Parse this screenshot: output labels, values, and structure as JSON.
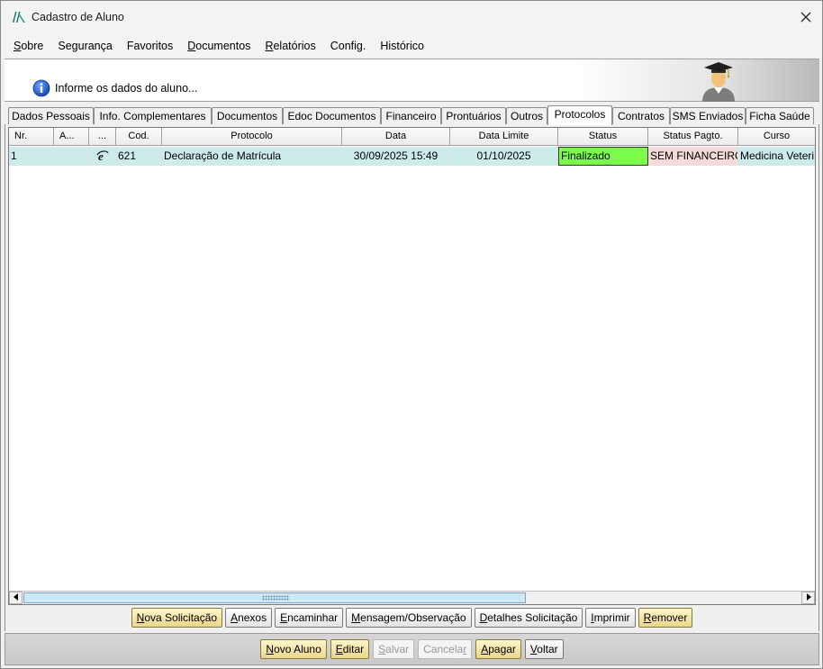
{
  "window": {
    "title": "Cadastro de Aluno"
  },
  "menu": [
    {
      "label": "Sobre",
      "underline": "S",
      "rest": "obre"
    },
    {
      "label": "Segurança",
      "underline": "",
      "rest": "Segurança"
    },
    {
      "label": "Favoritos",
      "underline": "",
      "rest": "Favoritos"
    },
    {
      "label": "Documentos",
      "underline": "D",
      "rest": "ocumentos"
    },
    {
      "label": "Relatórios",
      "underline": "R",
      "rest": "elatórios"
    },
    {
      "label": "Config.",
      "underline": "",
      "rest": "Config."
    },
    {
      "label": "Histórico",
      "underline": "",
      "rest": "Histórico"
    }
  ],
  "header": {
    "info_text": "Informe os dados do aluno..."
  },
  "tabs": [
    {
      "label": "Dados Pessoais"
    },
    {
      "label": "Info. Complementares"
    },
    {
      "label": "Documentos"
    },
    {
      "label": "Edoc Documentos"
    },
    {
      "label": "Financeiro"
    },
    {
      "label": "Prontuários"
    },
    {
      "label": "Outros"
    },
    {
      "label": "Protocolos",
      "active": true
    },
    {
      "label": "Contratos"
    },
    {
      "label": "SMS Enviados"
    },
    {
      "label": "Ficha Saúde"
    }
  ],
  "grid": {
    "columns": [
      "Nr.",
      "A...",
      "...",
      "Cod.",
      "Protocolo",
      "Data",
      "Data Limite",
      "Status",
      "Status Pagto.",
      "Curso"
    ],
    "rows": [
      {
        "nr": "1",
        "a": "",
        "icon": "ie-icon",
        "cod": "621",
        "protocolo": "Declaração de Matrícula",
        "data": "30/09/2025 15:49",
        "data_limite": "01/10/2025",
        "status": "Finalizado",
        "status_pagto": "SEM FINANCEIRO",
        "curso": "Medicina Veteri..."
      }
    ]
  },
  "actions": {
    "nova_solicitacao": {
      "u": "N",
      "rest": "ova Solicitação"
    },
    "anexos": {
      "u": "A",
      "rest": "nexos"
    },
    "encaminhar": {
      "u": "E",
      "rest": "ncaminhar"
    },
    "mensagem": {
      "u": "M",
      "rest": "ensagem/Observação"
    },
    "detalhes": {
      "u": "D",
      "rest": "etalhes Solicitação"
    },
    "imprimir": {
      "u": "I",
      "rest": "mprimir"
    },
    "remover": {
      "u": "R",
      "rest": "emover"
    }
  },
  "bottom": {
    "novo_aluno": {
      "u": "N",
      "rest": "ovo Aluno"
    },
    "editar": {
      "u": "E",
      "rest": "ditar"
    },
    "salvar": {
      "u": "S",
      "rest": "alvar"
    },
    "cancelar_pre": "Cancela",
    "cancelar_u": "r",
    "apagar": {
      "u": "A",
      "rest": "pagar"
    },
    "voltar": {
      "u": "V",
      "rest": "oltar"
    }
  },
  "colors": {
    "selected_row": "#cdebeb",
    "status_finalizado": "#7cfc4a",
    "status_pagto": "#f5dada",
    "yellow_button": "#e8d68a"
  }
}
